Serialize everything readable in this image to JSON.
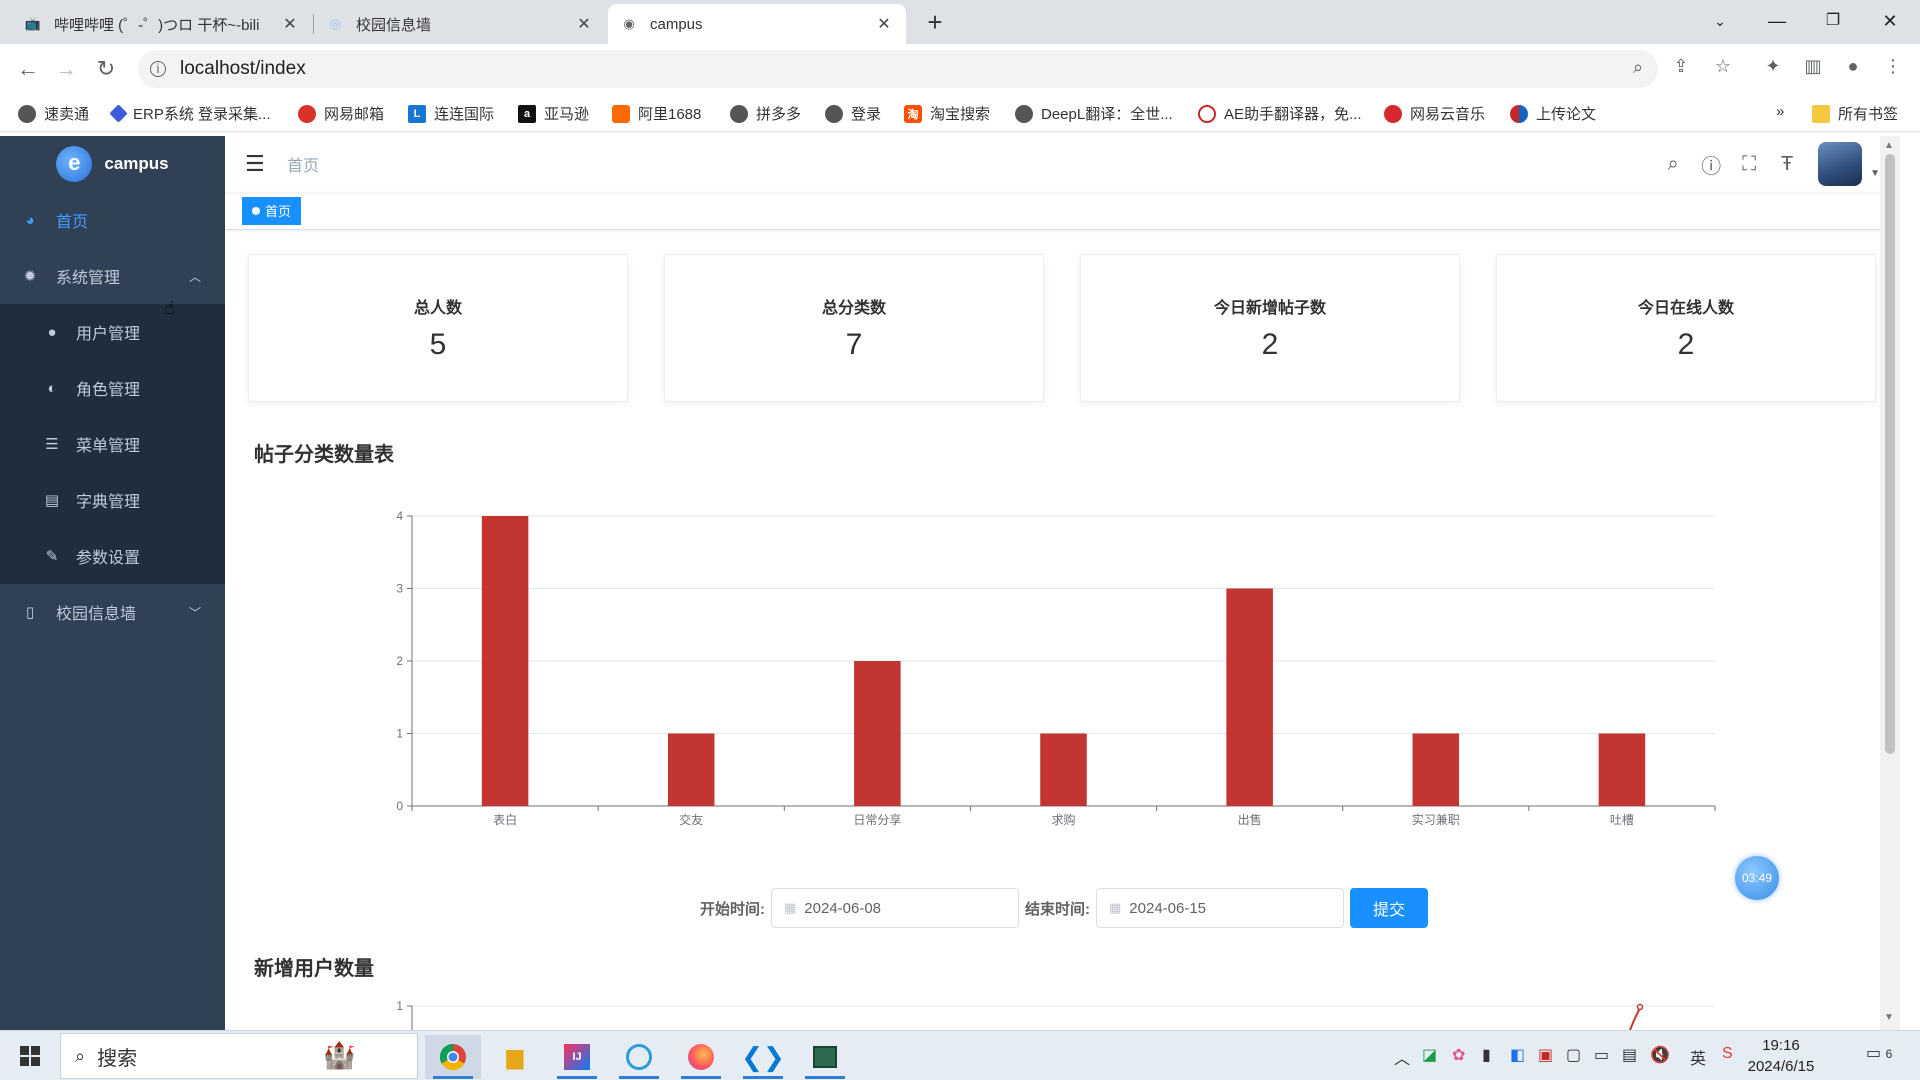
{
  "browser": {
    "tabs": [
      {
        "label": "哔哩哔哩 (゜-゜)つロ 干杯~-bili",
        "icon": "bilibili-icon",
        "active": false
      },
      {
        "label": "校园信息墙",
        "icon": "globe-icon",
        "active": false
      },
      {
        "label": "campus",
        "icon": "globe-icon",
        "active": true
      }
    ],
    "url": "localhost/index",
    "bookmarks": [
      {
        "label": "速卖通",
        "color": "#555555"
      },
      {
        "label": "ERP系统 登录采集...",
        "color": "#3b5bdb"
      },
      {
        "label": "网易邮箱",
        "color": "#d9322b"
      },
      {
        "label": "连连国际",
        "color": "#1976d2"
      },
      {
        "label": "亚马逊",
        "color": "#111111"
      },
      {
        "label": "阿里1688",
        "color": "#ff6a00"
      },
      {
        "label": "拼多多",
        "color": "#555555"
      },
      {
        "label": "登录",
        "color": "#555555"
      },
      {
        "label": "淘宝搜索",
        "color": "#ff5000"
      },
      {
        "label": "DeepL翻译：全世...",
        "color": "#555555"
      },
      {
        "label": "AE助手翻译器，免...",
        "color": "#555555"
      },
      {
        "label": "网易云音乐",
        "color": "#d4282c"
      },
      {
        "label": "上传论文",
        "color": "#c62828"
      }
    ],
    "bookmarks_more": "»",
    "all_bookmarks": "所有书签"
  },
  "sidebar": {
    "logo_text": "campus",
    "items": [
      {
        "label": "首页",
        "icon": "dashboard-icon",
        "active": true
      },
      {
        "label": "系统管理",
        "icon": "gear-icon",
        "expanded": true
      },
      {
        "label": "用户管理",
        "icon": "user-icon"
      },
      {
        "label": "角色管理",
        "icon": "peoples-icon"
      },
      {
        "label": "菜单管理",
        "icon": "tree-table-icon"
      },
      {
        "label": "字典管理",
        "icon": "dict-icon"
      },
      {
        "label": "参数设置",
        "icon": "edit-icon"
      },
      {
        "label": "校园信息墙",
        "icon": "book-icon",
        "expanded": false
      }
    ]
  },
  "navbar": {
    "breadcrumb": "首页"
  },
  "tags": {
    "active": "首页"
  },
  "cards": [
    {
      "title": "总人数",
      "value": "5"
    },
    {
      "title": "总分类数",
      "value": "7"
    },
    {
      "title": "今日新增帖子数",
      "value": "2"
    },
    {
      "title": "今日在线人数",
      "value": "2"
    }
  ],
  "section1_title": "帖子分类数量表",
  "section2_title": "新增用户数量",
  "timer": "03:49",
  "form": {
    "start_label": "开始时间:",
    "start_value": "2024-06-08",
    "end_label": "结束时间:",
    "end_value": "2024-06-15",
    "submit_label": "提交"
  },
  "chart_data": [
    {
      "type": "bar",
      "categories": [
        "表白",
        "交友",
        "日常分享",
        "求购",
        "出售",
        "实习兼职",
        "吐槽"
      ],
      "values": [
        4,
        1,
        2,
        1,
        3,
        1,
        1
      ],
      "ylim": [
        0,
        4
      ],
      "yticks": [
        0,
        1,
        2,
        3,
        4
      ],
      "color": "#c23531",
      "grid": true
    },
    {
      "type": "line",
      "yticks_visible": [
        1
      ],
      "color": "#c23531",
      "grid": true
    }
  ],
  "taskbar": {
    "search_placeholder": "搜索",
    "time": "19:16",
    "date": "2024/6/15",
    "ime": "英",
    "notification_count": "6"
  }
}
